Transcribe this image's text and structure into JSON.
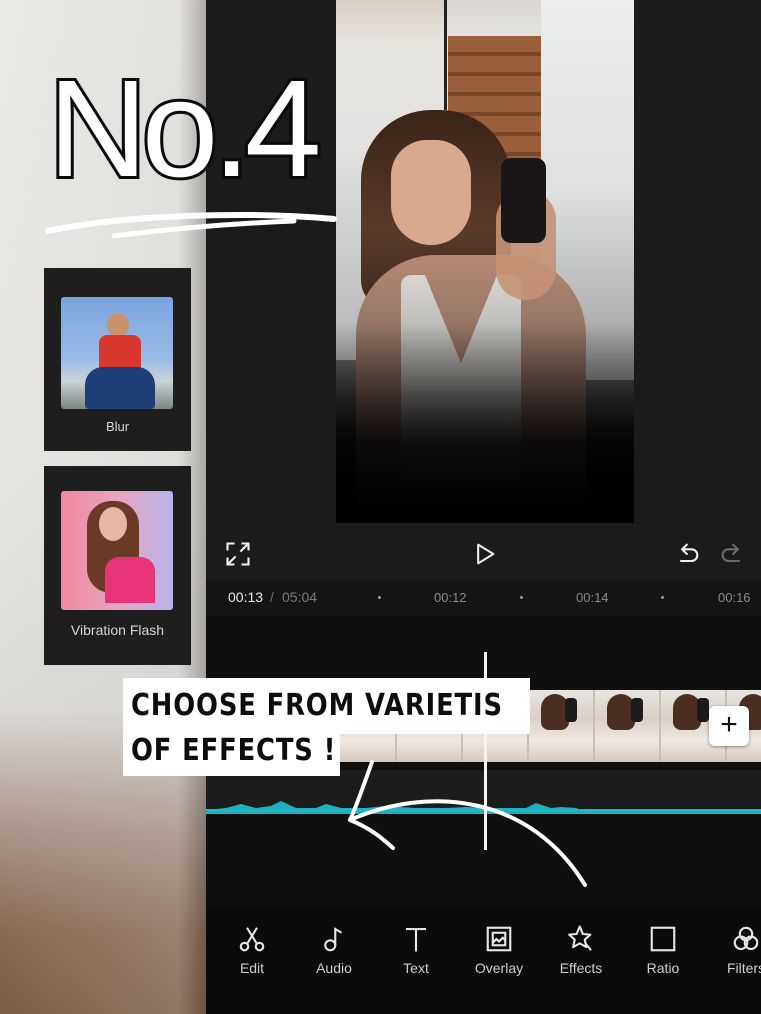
{
  "overlay": {
    "headline": "No.4",
    "callout_line1": "CHOOSE FROM VARIETIS",
    "callout_line2": "OF EFFECTS !"
  },
  "effect_cards": [
    {
      "label": "Blur",
      "thumbnail": "boy-red-shirt-photo"
    },
    {
      "label": "Vibration Flash",
      "thumbnail": "woman-pink-top-photo"
    }
  ],
  "player": {
    "fullscreen_icon": "expand-icon",
    "play_icon": "play-icon",
    "undo_icon": "undo-icon",
    "redo_icon": "redo-icon"
  },
  "timeline": {
    "current_time": "00:13",
    "separator": "/",
    "total_time": "05:04",
    "ticks": [
      "00:12",
      "00:14",
      "00:16"
    ],
    "add_clip_label": "+"
  },
  "toolbar": {
    "items": [
      {
        "label": "Edit",
        "icon": "scissors-icon"
      },
      {
        "label": "Audio",
        "icon": "music-note-icon"
      },
      {
        "label": "Text",
        "icon": "text-icon"
      },
      {
        "label": "Overlay",
        "icon": "overlay-icon"
      },
      {
        "label": "Effects",
        "icon": "effects-star-icon"
      },
      {
        "label": "Ratio",
        "icon": "ratio-icon"
      },
      {
        "label": "Filters",
        "icon": "filters-icon"
      }
    ]
  },
  "colors": {
    "editor_bg": "#1b1b1c",
    "toolbar_bg": "#0b0b0b",
    "waveform": "#1fb8c8",
    "callout_bg": "#ffffff"
  }
}
